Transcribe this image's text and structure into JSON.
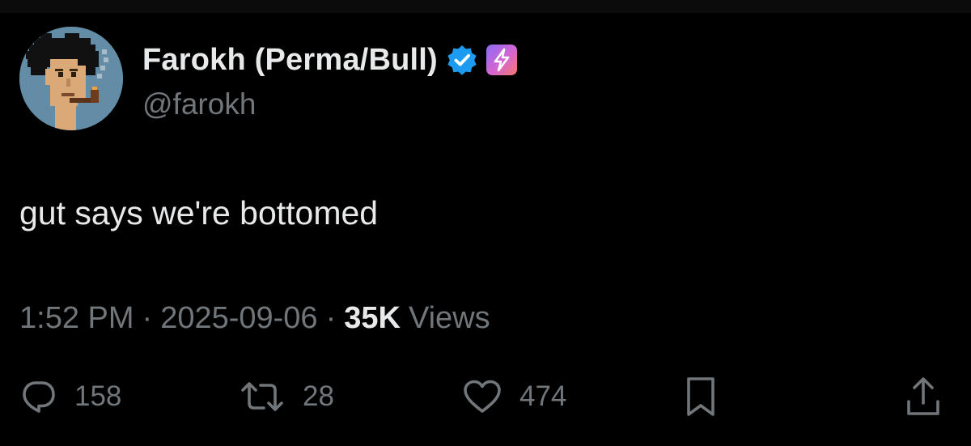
{
  "author": {
    "display_name": "Farokh (Perma/Bull)",
    "handle": "@farokh",
    "avatar_icon": "pixel-art-punk-avatar",
    "verified_icon": "verified-checkmark-icon",
    "premium_icon": "lightning-bolt-badge-icon"
  },
  "tweet": {
    "text": "gut says we're bottomed"
  },
  "meta": {
    "time": "1:52 PM",
    "separator": "·",
    "date": "2025-09-06",
    "views_count": "35K",
    "views_label": "Views"
  },
  "actions": {
    "replies": {
      "icon": "reply-icon",
      "count": "158"
    },
    "retweets": {
      "icon": "retweet-icon",
      "count": "28"
    },
    "likes": {
      "icon": "heart-icon",
      "count": "474"
    },
    "bookmark": {
      "icon": "bookmark-icon"
    },
    "share": {
      "icon": "share-icon"
    }
  },
  "colors": {
    "background": "#000000",
    "primary_text": "#e7e9ea",
    "secondary_text": "#71767b",
    "verified_blue": "#1d9bf0"
  }
}
